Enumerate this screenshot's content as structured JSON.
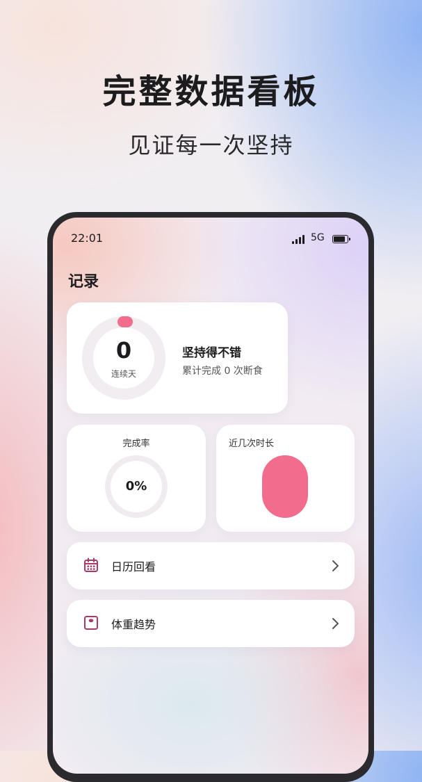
{
  "hero": {
    "title": "完整数据看板",
    "subtitle": "见证每一次坚持"
  },
  "status_bar": {
    "time": "22:01",
    "network": "5G",
    "icons": [
      "signal-icon",
      "battery-icon"
    ]
  },
  "page": {
    "title": "记录"
  },
  "streak": {
    "value": "0",
    "unit": "连续天",
    "headline": "坚持得不错",
    "subtext": "累计完成 0 次断食"
  },
  "completion_rate": {
    "title": "完成率",
    "value_text": "0%",
    "value": 0
  },
  "recent_duration": {
    "title": "近几次时长"
  },
  "menu": [
    {
      "label": "日历回看",
      "icon": "calendar-icon"
    },
    {
      "label": "体重趋势",
      "icon": "scale-icon"
    }
  ],
  "colors": {
    "accent": "#f26d8d",
    "icon": "#a8386a",
    "text": "#1c1c1e"
  }
}
